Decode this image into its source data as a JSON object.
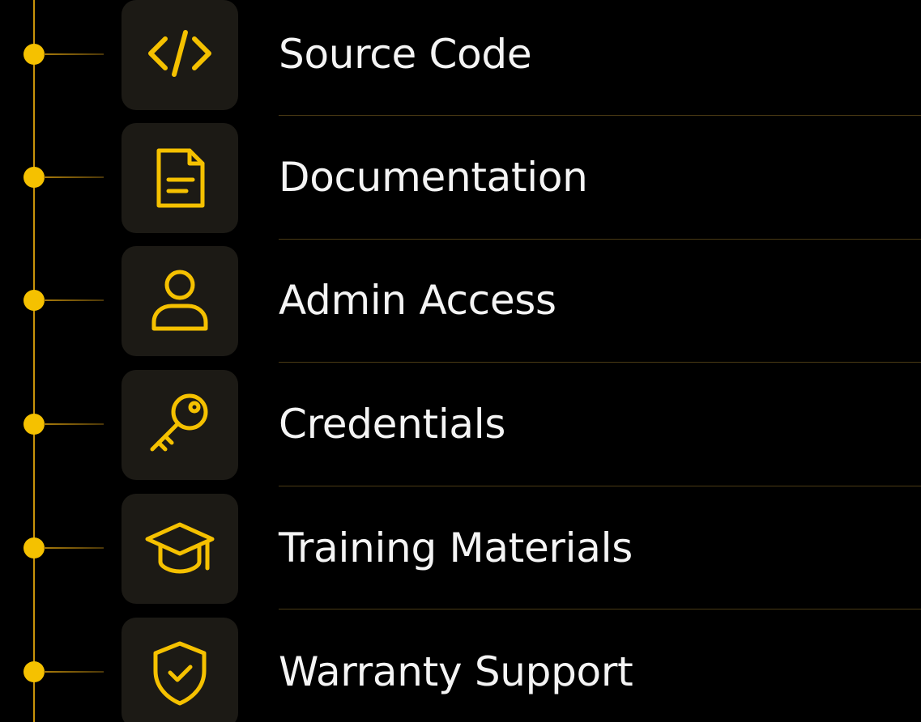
{
  "accent_color": "#f5c100",
  "items": [
    {
      "icon": "code-icon",
      "label": "Source Code"
    },
    {
      "icon": "document-icon",
      "label": "Documentation"
    },
    {
      "icon": "user-icon",
      "label": "Admin Access"
    },
    {
      "icon": "key-icon",
      "label": "Credentials"
    },
    {
      "icon": "graduation-cap-icon",
      "label": "Training Materials"
    },
    {
      "icon": "shield-check-icon",
      "label": "Warranty Support"
    }
  ]
}
